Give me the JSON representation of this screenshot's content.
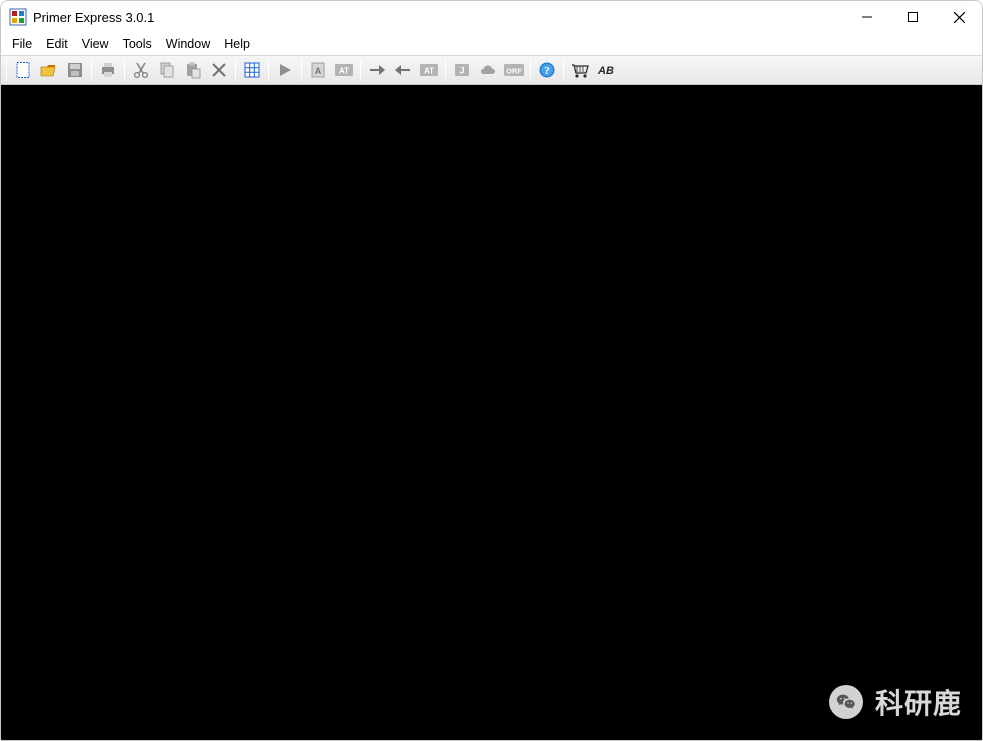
{
  "window": {
    "title": "Primer Express 3.0.1"
  },
  "menu": {
    "file": "File",
    "edit": "Edit",
    "view": "View",
    "tools": "Tools",
    "window": "Window",
    "help": "Help"
  },
  "toolbar": {
    "new": "new-document",
    "open": "open-folder",
    "save": "save",
    "print": "print",
    "cut": "cut",
    "copy": "copy",
    "paste": "paste",
    "delete": "delete",
    "grid": "grid-view",
    "play": "run",
    "doc_a": "document-a",
    "badge_at": "AT",
    "arrow_r": "forward",
    "arrow_l": "back",
    "badge_at2": "AT",
    "badge_j": "J",
    "cloud": "cloud",
    "badge_orf": "ORF",
    "help": "help",
    "cart": "order",
    "badge_ab": "AB"
  },
  "watermark": {
    "text": "科研鹿"
  }
}
